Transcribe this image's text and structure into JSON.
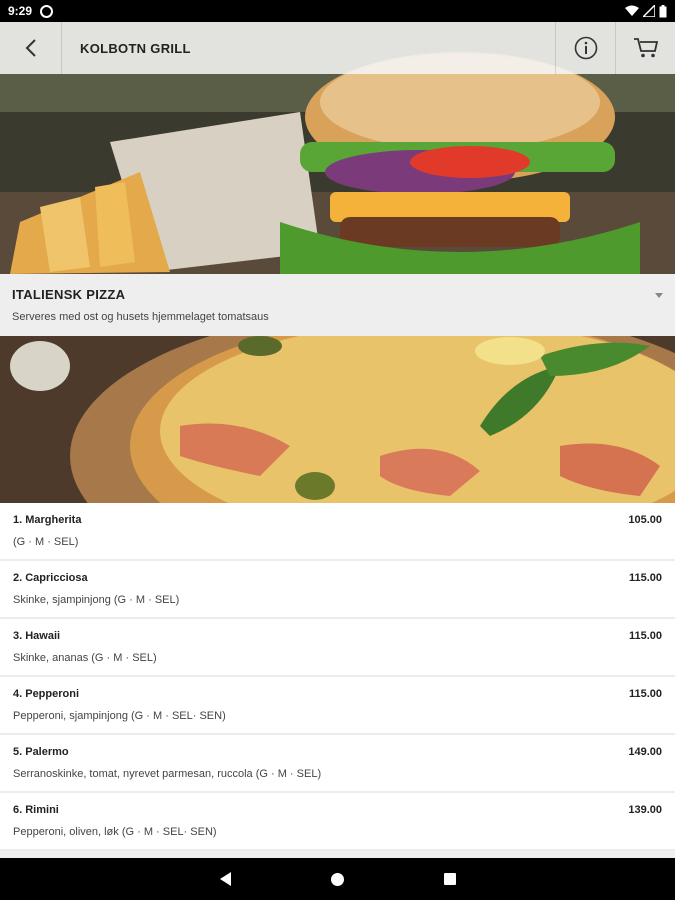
{
  "status_bar": {
    "time": "9:29"
  },
  "app_bar": {
    "title": "KOLBOTN GRILL",
    "back_icon": "arrow-back-icon",
    "info_icon": "info-icon",
    "cart_icon": "cart-icon"
  },
  "category": {
    "title": "ITALIENSK PIZZA",
    "description": "Serveres med ost og husets hjemmelaget tomatsaus"
  },
  "menu_items": [
    {
      "name": "1. Margherita",
      "price": "105.00",
      "description": "(G · M · SEL)"
    },
    {
      "name": "2. Capricciosa",
      "price": "115.00",
      "description": "Skinke, sjampinjong (G · M · SEL)"
    },
    {
      "name": "3. Hawaii",
      "price": "115.00",
      "description": "Skinke, ananas (G · M · SEL)"
    },
    {
      "name": "4. Pepperoni",
      "price": "115.00",
      "description": "Pepperoni, sjampinjong (G · M · SEL· SEN)"
    },
    {
      "name": "5. Palermo",
      "price": "149.00",
      "description": "Serranoskinke, tomat, nyrevet parmesan, ruccola (G · M · SEL)"
    },
    {
      "name": "6. Rimini",
      "price": "139.00",
      "description": "Pepperoni, oliven, løk (G · M · SEL· SEN)"
    }
  ],
  "colors": {
    "status_bar_bg": "#000000",
    "app_bar_bg": "#f5f5f5",
    "category_bg": "#eeeeee",
    "list_bg": "#ffffff",
    "nav_bar_bg": "#000000"
  }
}
